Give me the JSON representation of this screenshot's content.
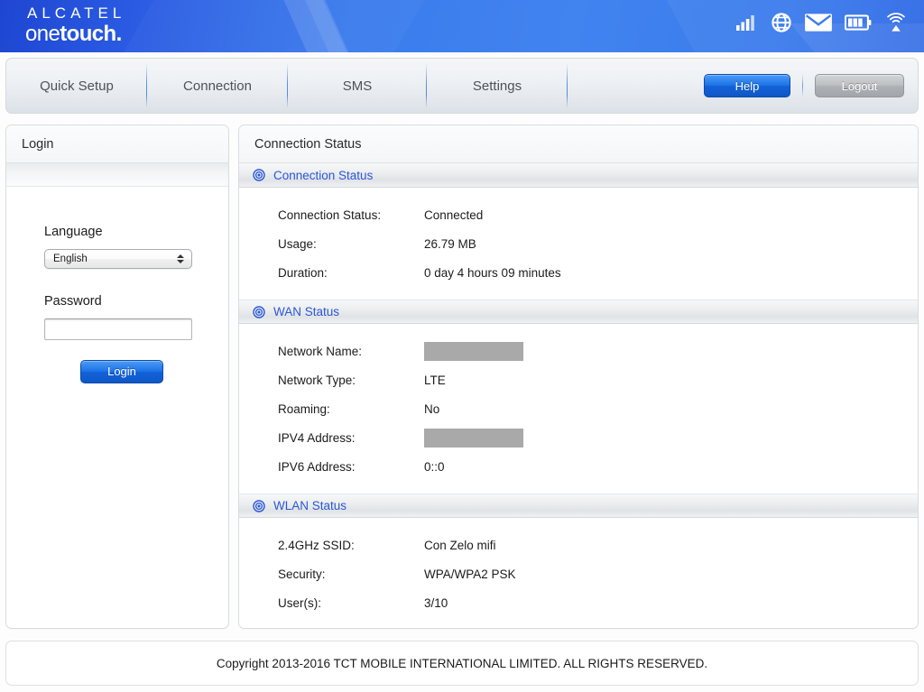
{
  "brand": {
    "logo_line1": "ALCATEL",
    "logo_line2_a": "one",
    "logo_line2_b": "touch.",
    "status_icons": [
      "signal-bars-icon",
      "globe-icon",
      "envelope-icon",
      "battery-icon",
      "wifi-broadcast-icon"
    ]
  },
  "nav": {
    "tabs": [
      {
        "label": "Quick Setup",
        "name": "tab-quick-setup"
      },
      {
        "label": "Connection",
        "name": "tab-connection"
      },
      {
        "label": "SMS",
        "name": "tab-sms"
      },
      {
        "label": "Settings",
        "name": "tab-settings"
      }
    ],
    "help_label": "Help",
    "logout_label": "Logout",
    "accent_color": "#1d73e8",
    "logout_color": "#aeb1b5"
  },
  "login": {
    "panel_title": "Login",
    "language_label": "Language",
    "language_value": "English",
    "password_label": "Password",
    "password_value": "",
    "password_placeholder": "",
    "login_button": "Login"
  },
  "main": {
    "panel_title": "Connection Status",
    "sections": [
      {
        "name": "connection-status",
        "heading": "Connection Status",
        "rows": [
          {
            "label": "Connection Status:",
            "value": "Connected",
            "redacted": false
          },
          {
            "label": "Usage:",
            "value": "26.79 MB",
            "redacted": false
          },
          {
            "label": "Duration:",
            "value": "0 day 4 hours 09 minutes",
            "redacted": false
          }
        ]
      },
      {
        "name": "wan-status",
        "heading": "WAN Status",
        "rows": [
          {
            "label": "Network Name:",
            "value": "",
            "redacted": true
          },
          {
            "label": "Network Type:",
            "value": "LTE",
            "redacted": false
          },
          {
            "label": "Roaming:",
            "value": "No",
            "redacted": false
          },
          {
            "label": "IPV4 Address:",
            "value": "",
            "redacted": true
          },
          {
            "label": "IPV6 Address:",
            "value": "0::0",
            "redacted": false
          }
        ]
      },
      {
        "name": "wlan-status",
        "heading": "WLAN Status",
        "rows": [
          {
            "label": "2.4GHz SSID:",
            "value": "Con Zelo mifi",
            "redacted": false
          },
          {
            "label": "Security:",
            "value": "WPA/WPA2 PSK",
            "redacted": false
          },
          {
            "label": "User(s):",
            "value": "3/10",
            "redacted": false
          }
        ]
      }
    ],
    "section_icon": "target-circle-icon",
    "section_heading_color": "#2b56d8"
  },
  "footer": {
    "copyright": "Copyright 2013-2016 TCT MOBILE INTERNATIONAL LIMITED. ALL RIGHTS RESERVED."
  }
}
